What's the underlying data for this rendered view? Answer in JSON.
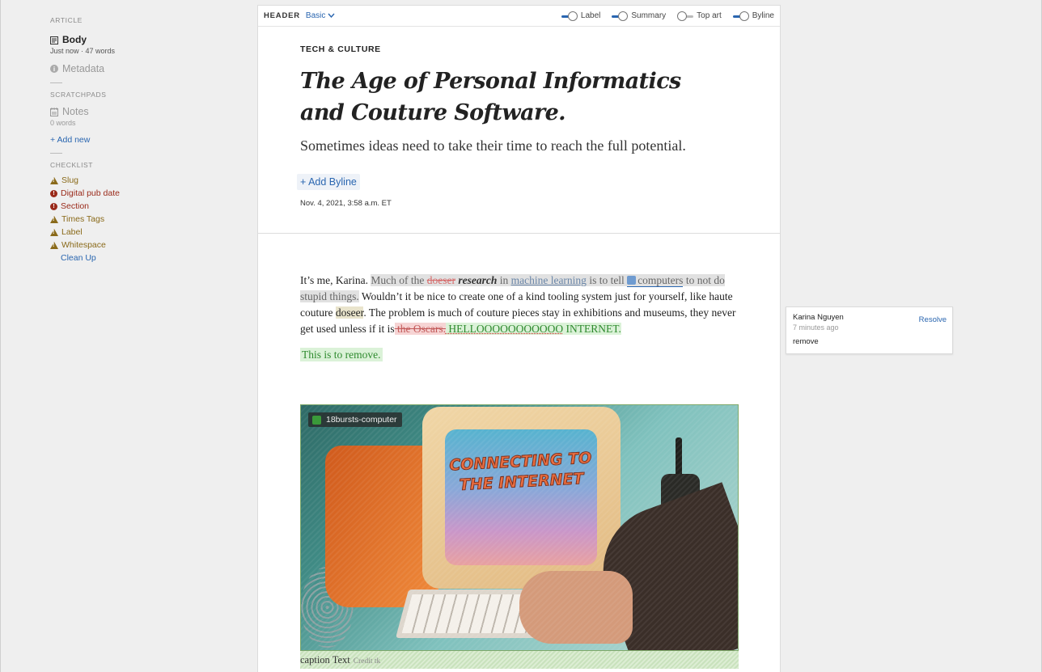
{
  "sidebar": {
    "article_title": "ARTICLE",
    "body": {
      "label": "Body",
      "sub": "Just now · 47 words"
    },
    "metadata": {
      "label": "Metadata"
    },
    "scratchpads_title": "SCRATCHPADS",
    "notes": {
      "label": "Notes",
      "sub": "0 words"
    },
    "add_new": "+  Add new",
    "checklist_title": "CHECKLIST",
    "checklist": [
      {
        "label": "Slug",
        "level": "warning"
      },
      {
        "label": "Digital pub date",
        "level": "error"
      },
      {
        "label": "Section",
        "level": "error"
      },
      {
        "label": "Times Tags",
        "level": "warning"
      },
      {
        "label": "Label",
        "level": "warning"
      },
      {
        "label": "Whitespace",
        "level": "warning"
      }
    ],
    "clean_up": "Clean Up"
  },
  "toolbar": {
    "header": "HEADER",
    "mode": "Basic",
    "toggles": [
      {
        "label": "Label",
        "on": true
      },
      {
        "label": "Summary",
        "on": true
      },
      {
        "label": "Top art",
        "on": false
      },
      {
        "label": "Byline",
        "on": true
      }
    ]
  },
  "article": {
    "kicker": "TECH & CULTURE",
    "headline": "The Age of Personal Informatics and Couture Software.",
    "summary": "Sometimes ideas need to take their time to reach the full potential.",
    "add_byline": "+ Add Byline",
    "dateline": "Nov. 4, 2021, 3:58 a.m. ET",
    "p1": {
      "a": "It’s me, Karina. ",
      "b": "Much of the ",
      "c": "doeser",
      "d": " ",
      "e": "research",
      "f": " in ",
      "g": "machine learning",
      "h": " is to tell ",
      "i": "computers",
      "j": " to not do stupid things.",
      "k": " Wouldn’t it be nice to create one of a kind tooling system just for yourself, like haute couture ",
      "l": "doseer",
      "m": ". The problem is much of couture pieces stay in exhibitions and museums, they never get used unless if it is",
      "n": " the Oscars.",
      "o": " HELLOOOOOOOOOOO",
      "p": " INTERNET."
    },
    "p2": "This is to remove.",
    "image": {
      "label": "18bursts-computer",
      "screen_text": "CONNECTING TO THE INTERNET"
    },
    "caption": "caption Text",
    "credit": "Credit tk"
  },
  "comment": {
    "author": "Karina Nguyen",
    "time": "7 minutes ago",
    "resolve": "Resolve",
    "message": "remove"
  }
}
